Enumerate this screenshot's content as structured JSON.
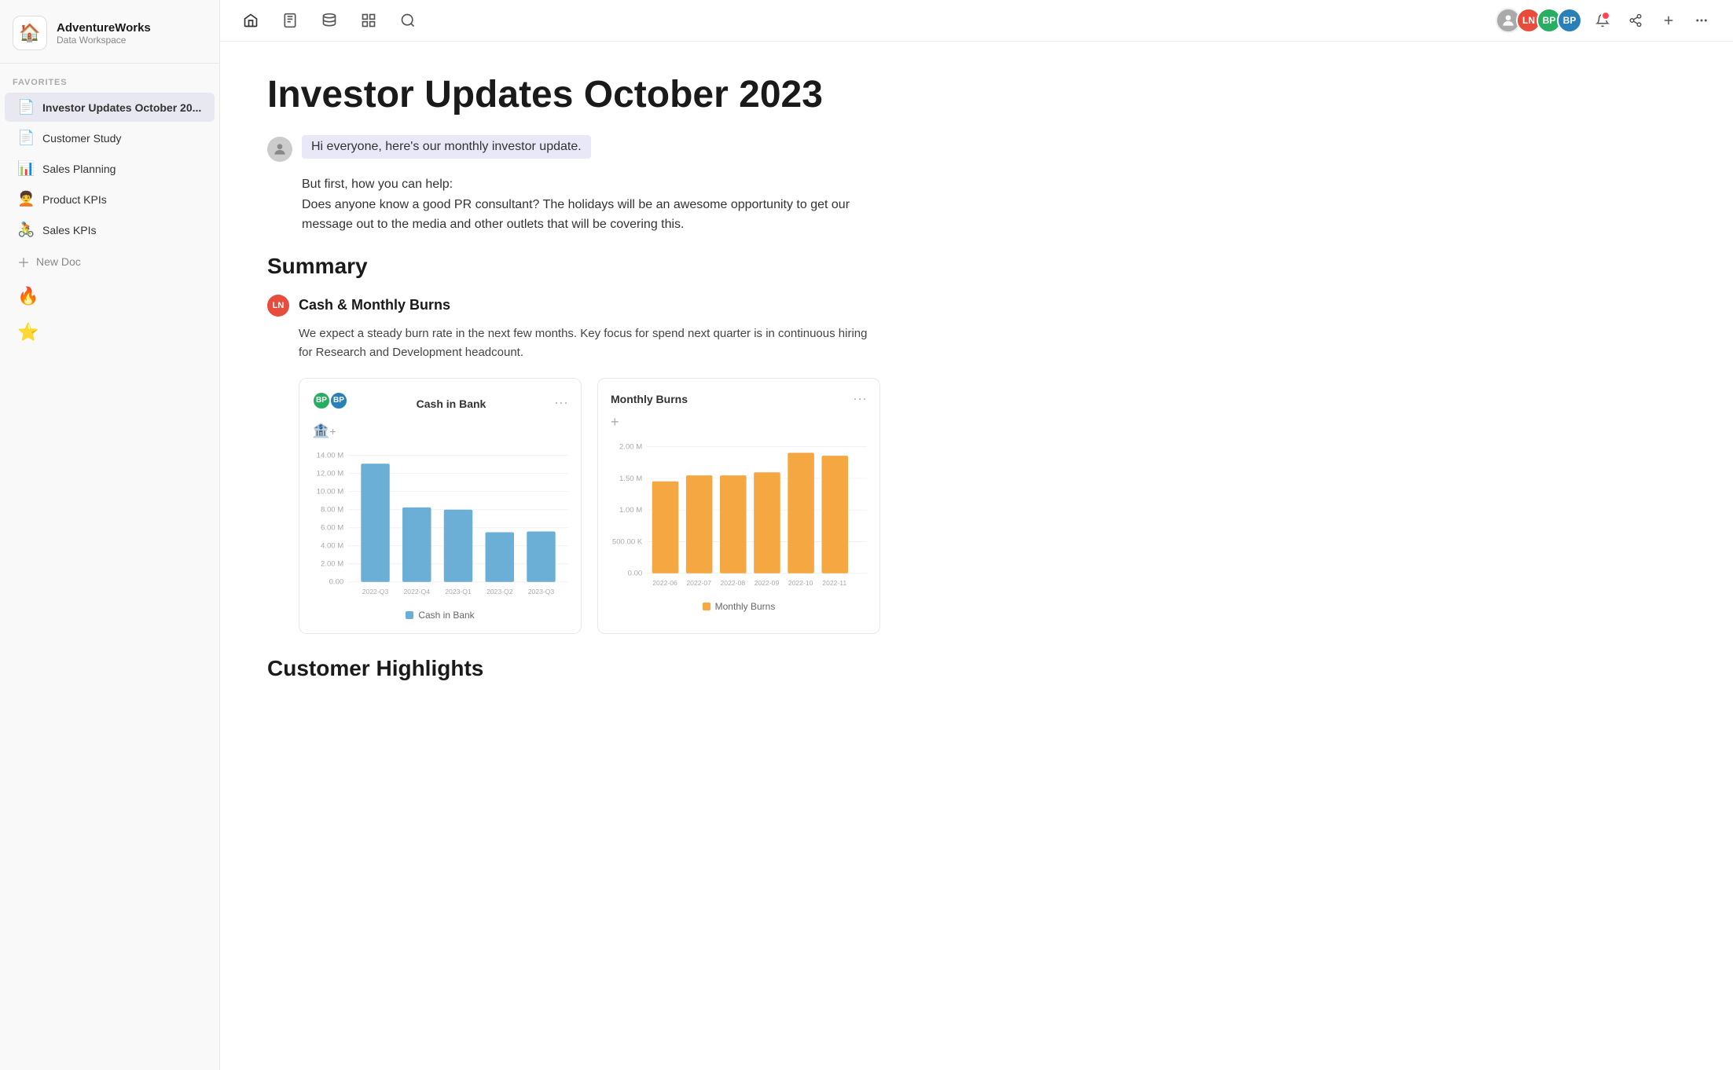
{
  "app": {
    "logo_emoji": "🏠",
    "brand_name": "AdventureWorks",
    "brand_sub": "Data Workspace"
  },
  "sidebar": {
    "favorites_label": "FAVORITES",
    "items": [
      {
        "id": "investor-updates",
        "icon": "",
        "label": "Investor Updates October 20...",
        "active": true
      },
      {
        "id": "customer-study",
        "icon": "",
        "label": "Customer Study",
        "active": false
      },
      {
        "id": "sales-planning",
        "icon": "📊",
        "label": "Sales Planning",
        "active": false
      },
      {
        "id": "product-kpis",
        "icon": "🧑‍🦱",
        "label": "Product KPIs",
        "active": false
      },
      {
        "id": "sales-kpis",
        "icon": "",
        "label": "Sales KPIs",
        "active": false
      }
    ],
    "new_doc_label": "New Doc",
    "emoji1": "🔥",
    "emoji2": "⭐"
  },
  "topbar": {
    "icons": [
      "home",
      "document",
      "database",
      "grid",
      "search"
    ],
    "users": [
      {
        "initials": "",
        "color": "#888",
        "is_photo": true
      },
      {
        "initials": "LN",
        "color": "#e74c3c"
      },
      {
        "initials": "BP",
        "color": "#27ae60"
      },
      {
        "initials": "BP",
        "color": "#2980b9"
      }
    ]
  },
  "page": {
    "title": "Investor Updates October 2023",
    "intro_text": "Hi everyone, here's our monthly investor update.",
    "body_text": "But first, how you can help:\nDoes anyone know a good PR consultant? The holidays will be an awesome opportunity to get our message out to the media and other outlets that will be covering this.",
    "summary_heading": "Summary",
    "subsection1": {
      "avatar_initials": "LN",
      "avatar_color": "#e74c3c",
      "title": "Cash & Monthly Burns",
      "body": "We expect a steady burn rate in the next few months. Key focus for spend next quarter is in continuous hiring for Research and Development headcount."
    },
    "chart1": {
      "title": "Cash in Bank",
      "legend": "Cash in Bank",
      "legend_color": "#6baed6",
      "bar_color": "#6baed6",
      "labels": [
        "2022-Q3",
        "2022-Q4",
        "2023-Q1",
        "2023-Q2",
        "2023-Q3"
      ],
      "values": [
        13.0,
        8.2,
        8.0,
        5.5,
        5.6
      ],
      "max": 14,
      "y_labels": [
        "14.00 M",
        "12.00 M",
        "10.00 M",
        "8.00 M",
        "6.00 M",
        "4.00 M",
        "2.00 M",
        "0.00"
      ]
    },
    "chart2": {
      "title": "Monthly Burns",
      "legend": "Monthly Burns",
      "legend_color": "#f5a742",
      "bar_color": "#f5a742",
      "labels": [
        "2022-06",
        "2022-07",
        "2022-08",
        "2022-09",
        "2022-10",
        "2022-11"
      ],
      "values": [
        1.45,
        1.55,
        1.55,
        1.6,
        1.9,
        1.85
      ],
      "max": 2.0,
      "y_labels": [
        "2.00 M",
        "1.50 M",
        "1.00 M",
        "500.00 K",
        "0.00"
      ]
    }
  }
}
